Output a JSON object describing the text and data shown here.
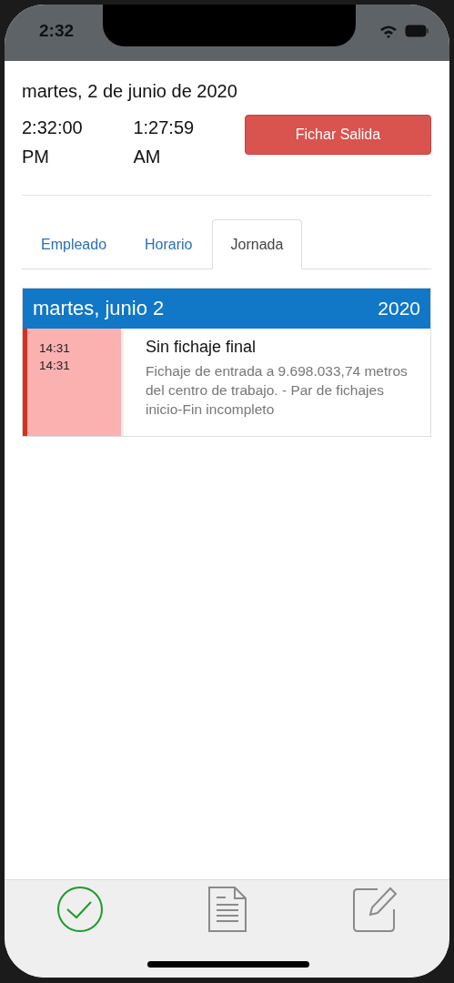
{
  "status_bar": {
    "time": "2:32"
  },
  "header": {
    "date": "martes, 2 de junio de 2020",
    "clocks": [
      {
        "time": "2:32:00",
        "period": "PM"
      },
      {
        "time": "1:27:59",
        "period": "AM"
      }
    ],
    "action_button": "Fichar Salida"
  },
  "tabs": [
    {
      "label": "Empleado",
      "selected": false
    },
    {
      "label": "Horario",
      "selected": false
    },
    {
      "label": "Jornada",
      "selected": true
    }
  ],
  "day": {
    "title": "martes, junio 2",
    "year": "2020",
    "entries": [
      {
        "times": [
          "14:31",
          "14:31"
        ],
        "title": "Sin fichaje final",
        "description": "Fichaje de entrada a 9.698.033,74 metros del centro de trabajo. - Par de fichajes inicio-Fin incompleto"
      }
    ]
  },
  "tab_bar": [
    {
      "kind": "check",
      "selected": true
    },
    {
      "kind": "document",
      "selected": false
    },
    {
      "kind": "edit",
      "selected": false
    }
  ]
}
